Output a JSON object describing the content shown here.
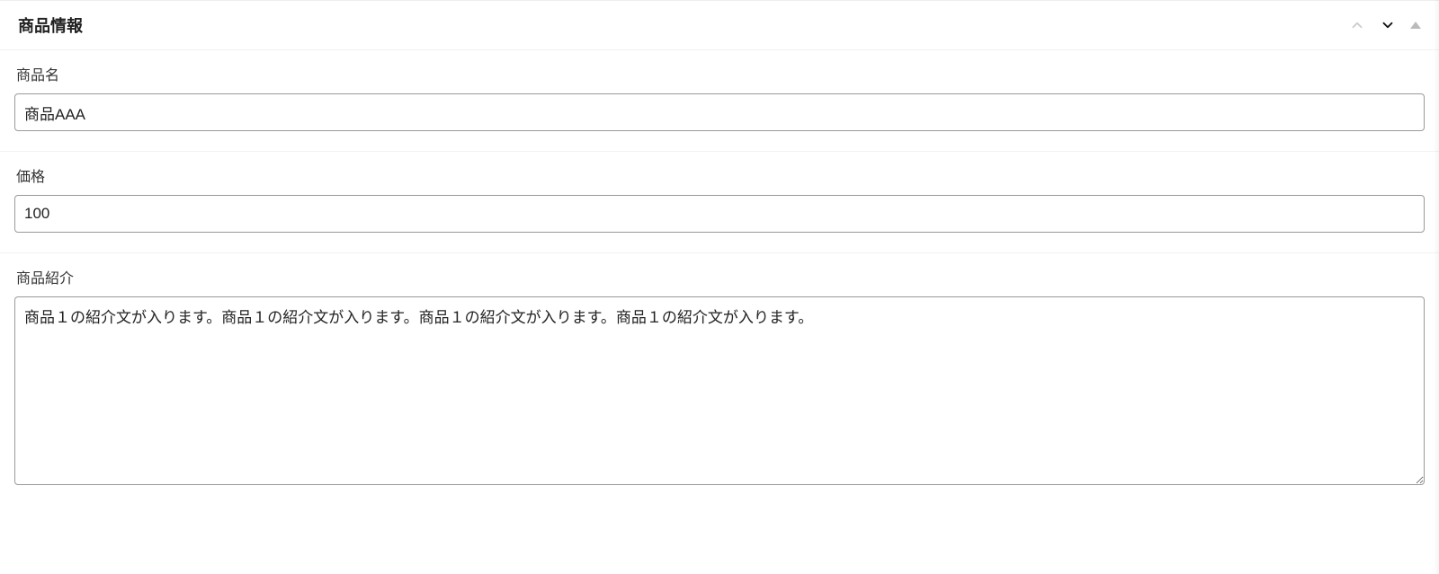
{
  "panel": {
    "title": "商品情報"
  },
  "fields": {
    "name": {
      "label": "商品名",
      "value": "商品AAA"
    },
    "price": {
      "label": "価格",
      "value": "100"
    },
    "intro": {
      "label": "商品紹介",
      "value": "商品１の紹介文が入ります。商品１の紹介文が入ります。商品１の紹介文が入ります。商品１の紹介文が入ります。"
    }
  }
}
